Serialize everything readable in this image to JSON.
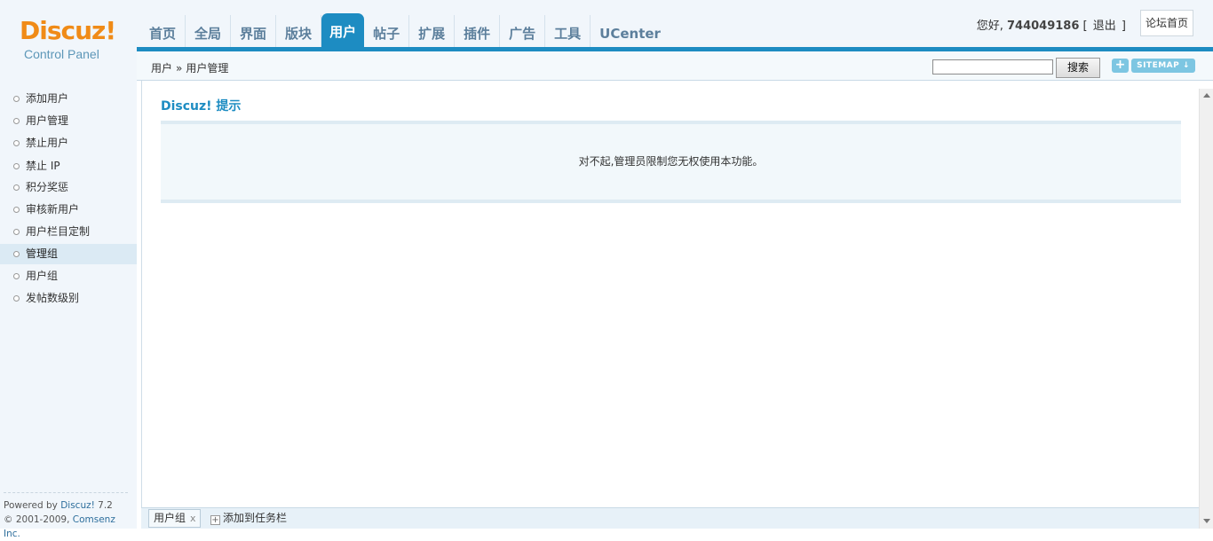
{
  "logo": {
    "main": "Discuz!",
    "sub": "Control Panel"
  },
  "topnav": {
    "tabs": [
      {
        "label": "首页",
        "active": false
      },
      {
        "label": "全局",
        "active": false
      },
      {
        "label": "界面",
        "active": false
      },
      {
        "label": "版块",
        "active": false
      },
      {
        "label": "用户",
        "active": true
      },
      {
        "label": "帖子",
        "active": false
      },
      {
        "label": "扩展",
        "active": false
      },
      {
        "label": "插件",
        "active": false
      },
      {
        "label": "广告",
        "active": false
      },
      {
        "label": "工具",
        "active": false
      },
      {
        "label": "UCenter",
        "active": false
      }
    ]
  },
  "userbar": {
    "greeting": "您好,",
    "username": "744049186",
    "bracket_open": "[",
    "logout": "退出",
    "bracket_close": "]",
    "forum_home": "论坛首页"
  },
  "breadcrumb": {
    "parent": "用户",
    "separator": "»",
    "current": "用户管理"
  },
  "search": {
    "value": "",
    "button": "搜索"
  },
  "sitemap": {
    "plus": "+",
    "label": "SITEMAP ↓"
  },
  "sidebar": {
    "items": [
      {
        "label": "添加用户",
        "active": false
      },
      {
        "label": "用户管理",
        "active": false
      },
      {
        "label": "禁止用户",
        "active": false
      },
      {
        "label": "禁止 IP",
        "active": false
      },
      {
        "label": "积分奖惩",
        "active": false
      },
      {
        "label": "审核新用户",
        "active": false
      },
      {
        "label": "用户栏目定制",
        "active": false
      },
      {
        "label": "管理组",
        "active": true
      },
      {
        "label": "用户组",
        "active": false
      },
      {
        "label": "发帖数级别",
        "active": false
      }
    ],
    "powered_prefix": "Powered by ",
    "powered_brand": "Discuz!",
    "powered_version": " 7.2",
    "copyright_prefix": "© 2001-2009, ",
    "copyright_company": "Comsenz Inc."
  },
  "main": {
    "title": "Discuz! 提示",
    "message": "对不起,管理员限制您无权使用本功能。"
  },
  "taskbar": {
    "tab_label": "用户组",
    "tab_close": "x",
    "add_icon": "+",
    "add_label": "添加到任务栏"
  },
  "colors": {
    "accent": "#1d8cc2",
    "logo": "#f08b17",
    "sidebar_bg": "#f1f6fb"
  }
}
